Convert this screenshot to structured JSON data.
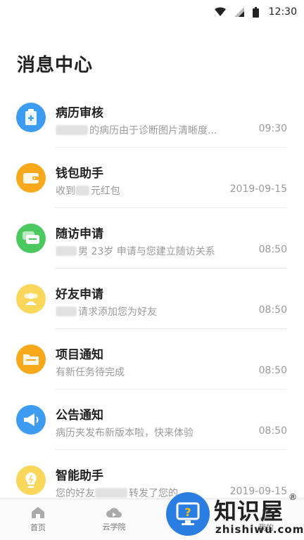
{
  "status_bar": {
    "time": "12:30"
  },
  "page_title": "消息中心",
  "messages": [
    {
      "title": "病历审核",
      "preview": "的病历由于诊断图片清晰度...",
      "time": "09:30",
      "icon": "medical-record-icon",
      "color": "#3d9cf0"
    },
    {
      "title": "钱包助手",
      "preview_prefix": "收到",
      "preview": "元红包",
      "time": "2019-09-15",
      "icon": "wallet-icon",
      "color": "#f7a81b"
    },
    {
      "title": "随访申请",
      "preview": "男 23岁 申请与您建立随访关系",
      "time": "08:50",
      "icon": "chat-bubble-icon",
      "color": "#4cc95e"
    },
    {
      "title": "好友申请",
      "preview": "请求添加您为好友",
      "time": "08:50",
      "icon": "friends-icon",
      "color": "#f9d75a"
    },
    {
      "title": "项目通知",
      "preview": "有新任务待完成",
      "time": "08:50",
      "icon": "folder-icon",
      "color": "#f7a81b"
    },
    {
      "title": "公告通知",
      "preview": "病历夹发布新版本啦，快来体验",
      "time": "08:50",
      "icon": "megaphone-icon",
      "color": "#3d9cf0"
    },
    {
      "title": "智能助手",
      "preview_prefix": "您的好友",
      "preview": "转发了您的",
      "time": "2019-09-15",
      "icon": "lightbulb-icon",
      "color": "#f9d75a"
    }
  ],
  "tabbar": {
    "tabs": [
      {
        "label": "首页",
        "icon": "home-icon"
      },
      {
        "label": "云学院",
        "icon": "cloud-icon"
      },
      {
        "label": "",
        "icon": ""
      },
      {
        "label": "我的",
        "icon": "profile-icon"
      }
    ]
  },
  "watermark": {
    "brand": "知识屋",
    "reg": "®",
    "domain": "zhishiwu.com"
  }
}
